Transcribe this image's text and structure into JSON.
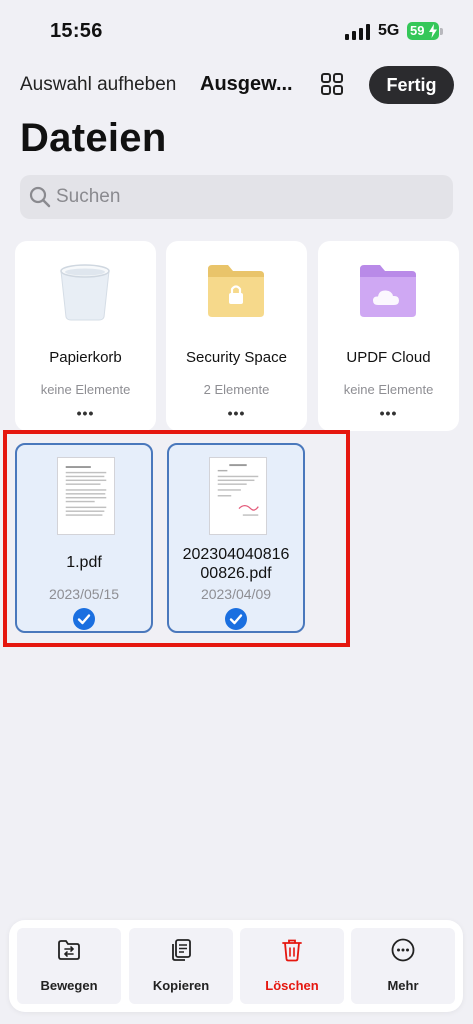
{
  "status_bar": {
    "time": "15:56",
    "network": "5G",
    "battery": "59"
  },
  "nav": {
    "deselect_label": "Auswahl aufheben",
    "title": "Ausgew...",
    "done_label": "Fertig"
  },
  "page": {
    "title": "Dateien"
  },
  "search": {
    "placeholder": "Suchen"
  },
  "folders": [
    {
      "name": "Papierkorb",
      "subtitle": "keine Elemente",
      "icon": "trash-bin-icon"
    },
    {
      "name": "Security Space",
      "subtitle": "2 Elemente",
      "icon": "lock-folder-icon"
    },
    {
      "name": "UPDF Cloud",
      "subtitle": "keine Elemente",
      "icon": "cloud-folder-icon"
    }
  ],
  "files": [
    {
      "name": "1.pdf",
      "date": "2023/05/15",
      "selected": true
    },
    {
      "name": "202304040816\n00826.pdf",
      "date": "2023/04/09",
      "selected": true
    }
  ],
  "toolbar": {
    "move": "Bewegen",
    "copy": "Kopieren",
    "delete": "Löschen",
    "more": "Mehr"
  },
  "colors": {
    "accent": "#1a6fe0",
    "danger": "#e5170f",
    "highlight": "#e5170f",
    "selected_bg": "#e6eefa",
    "selected_border": "#4a78bc"
  }
}
